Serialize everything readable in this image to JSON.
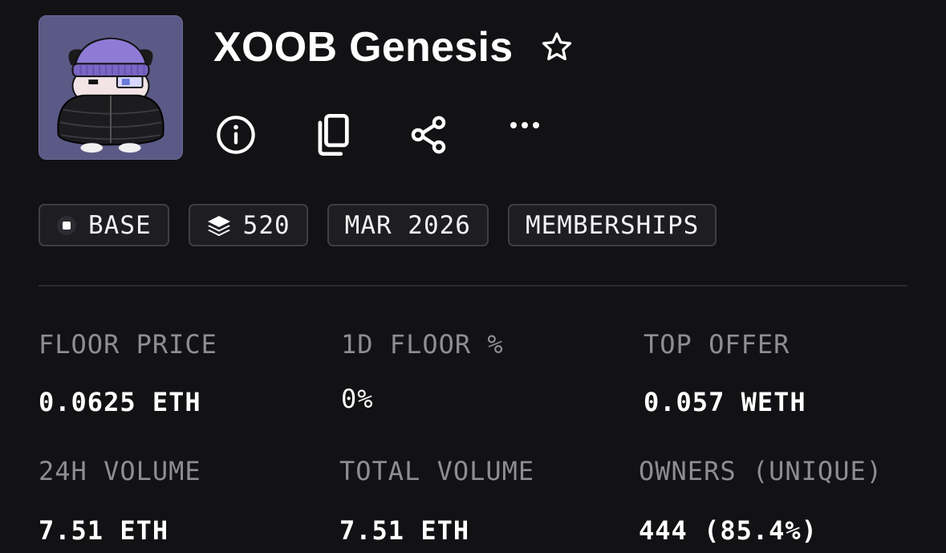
{
  "collection": {
    "title": "XOOB Genesis"
  },
  "icons": {
    "favorite": "star-outline-icon",
    "info": "info-circle-icon",
    "copy": "copy-icon",
    "share": "share-icon",
    "more": "more-horizontal-icon",
    "chain": "base-chain-icon",
    "supply": "layers-icon"
  },
  "chips": {
    "chain": "BASE",
    "supply": "520",
    "date": "MAR 2026",
    "category": "MEMBERSHIPS"
  },
  "stats": {
    "floor_price": {
      "label": "FLOOR PRICE",
      "value": "0.0625 ETH"
    },
    "floor_change_1d": {
      "label": "1D FLOOR %",
      "value": "0%"
    },
    "top_offer": {
      "label": "TOP OFFER",
      "value": "0.057 WETH"
    },
    "volume_24h": {
      "label": "24H VOLUME",
      "value": "7.51 ETH"
    },
    "total_volume": {
      "label": "TOTAL VOLUME",
      "value": "7.51 ETH"
    },
    "owners": {
      "label": "OWNERS (UNIQUE)",
      "value": "444 (85.4%)"
    }
  },
  "colors": {
    "background": "#121114",
    "avatar_bg": "#5b5a86",
    "chip_border": "#3f3e44",
    "label": "#8e8d93",
    "text": "#ffffff"
  }
}
